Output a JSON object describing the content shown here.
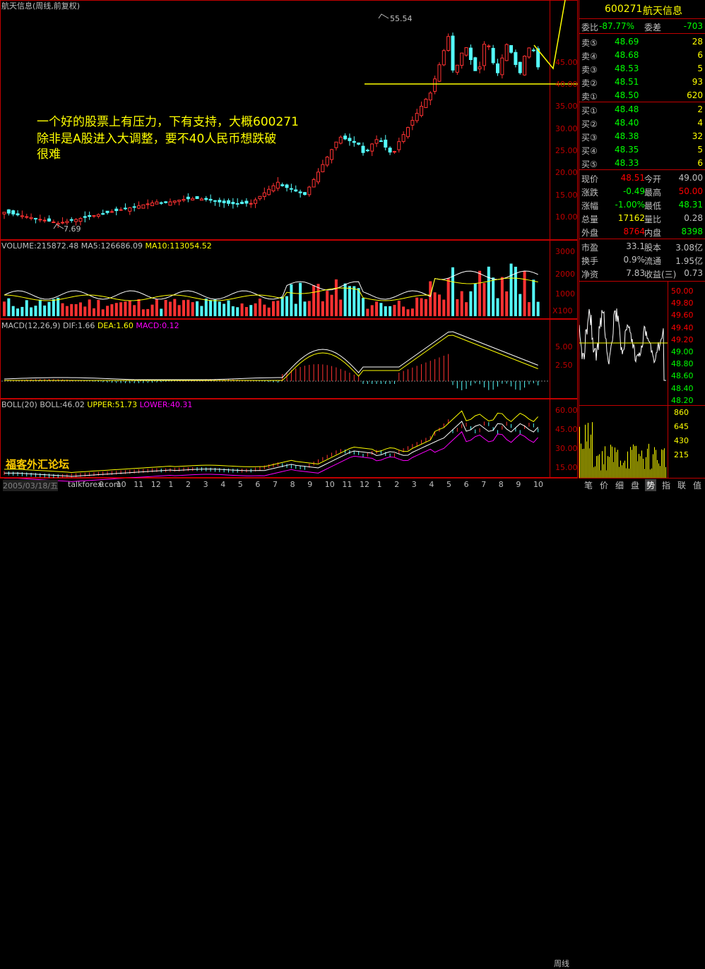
{
  "window_title": "航天信息(周线,前复权)",
  "annotation": {
    "line1": "一个好的股票上有压力，下有支持，大概600271",
    "line2": "除非是A股进入大调整，要不40人民币想跌破",
    "line3": "很难"
  },
  "price_labels": {
    "high": "55.54",
    "low": "7.69"
  },
  "price_axis": [
    "45.00",
    "40.00",
    "35.00",
    "30.00",
    "25.00",
    "20.00",
    "15.00",
    "10.00"
  ],
  "volume_panel": {
    "label": "VOLUME:215872.48",
    "ma5": "MA5:126686.09",
    "ma10": "MA10:113054.52",
    "axis": [
      "3000",
      "2000",
      "1000"
    ],
    "unit": "X100"
  },
  "macd_panel": {
    "label": "MACD(12,26,9)",
    "dif": "DIF:1.66",
    "dea": "DEA:1.60",
    "macd": "MACD:0.12",
    "axis": [
      "5.00",
      "2.50"
    ]
  },
  "boll_panel": {
    "label": "BOLL(20)",
    "boll": "BOLL:46.02",
    "upper": "UPPER:51.73",
    "lower": "LOWER:40.31",
    "axis": [
      "60.00",
      "45.00",
      "30.00",
      "15.00"
    ]
  },
  "date_label": "2005/03/18/五",
  "x_ticks": [
    "9",
    "10",
    "11",
    "12",
    "1",
    "2",
    "3",
    "4",
    "5",
    "6",
    "7",
    "8",
    "9",
    "10",
    "11",
    "12",
    "1",
    "2",
    "3",
    "4",
    "5",
    "6",
    "7",
    "8",
    "9",
    "10"
  ],
  "period": "周线",
  "watermark": "福客外汇论坛",
  "watermark2": "talkforex.com",
  "quote": {
    "code": "600271",
    "name": "航天信息",
    "weibi_label": "委比",
    "weibi_value": "-87.77%",
    "weicha_label": "委差",
    "weicha_value": "-703",
    "sells": [
      {
        "label": "卖⑤",
        "price": "48.69",
        "vol": "28"
      },
      {
        "label": "卖④",
        "price": "48.68",
        "vol": "6"
      },
      {
        "label": "卖③",
        "price": "48.53",
        "vol": "5"
      },
      {
        "label": "卖②",
        "price": "48.51",
        "vol": "93"
      },
      {
        "label": "卖①",
        "price": "48.50",
        "vol": "620"
      }
    ],
    "buys": [
      {
        "label": "买①",
        "price": "48.48",
        "vol": "2"
      },
      {
        "label": "买②",
        "price": "48.40",
        "vol": "4"
      },
      {
        "label": "买③",
        "price": "48.38",
        "vol": "32"
      },
      {
        "label": "买④",
        "price": "48.35",
        "vol": "5"
      },
      {
        "label": "买⑤",
        "price": "48.33",
        "vol": "6"
      }
    ],
    "stats": [
      {
        "l1": "现价",
        "v1": "48.51",
        "l2": "今开",
        "v2": "49.00",
        "c1": "#ff0000",
        "c2": "#c0c0c0"
      },
      {
        "l1": "涨跌",
        "v1": "-0.49",
        "l2": "最高",
        "v2": "50.00",
        "c1": "#00ff00",
        "c2": "#ff0000"
      },
      {
        "l1": "涨幅",
        "v1": "-1.00%",
        "l2": "最低",
        "v2": "48.31",
        "c1": "#00ff00",
        "c2": "#00ff00"
      },
      {
        "l1": "总量",
        "v1": "17162",
        "l2": "量比",
        "v2": "0.28",
        "c1": "#ffff00",
        "c2": "#c0c0c0"
      },
      {
        "l1": "外盘",
        "v1": "8764",
        "l2": "内盘",
        "v2": "8398",
        "c1": "#ff0000",
        "c2": "#00ff00"
      }
    ],
    "fund": [
      {
        "l1": "市盈",
        "v1": "33.1",
        "l2": "股本",
        "v2": "3.08亿"
      },
      {
        "l1": "换手",
        "v1": "0.9%",
        "l2": "流通",
        "v2": "1.95亿"
      },
      {
        "l1": "净资",
        "v1": "7.83",
        "l2": "收益(三)",
        "v2": "0.73"
      }
    ],
    "intraday_axis": [
      "50.00",
      "49.80",
      "49.60",
      "49.40",
      "49.20",
      "49.00",
      "48.80",
      "48.60",
      "48.40",
      "48.20"
    ],
    "intraday_vol_axis": [
      "860",
      "645",
      "430",
      "215"
    ]
  },
  "tabs": [
    "笔",
    "价",
    "细",
    "盘",
    "势",
    "指",
    "联",
    "值"
  ],
  "active_tab": "势"
}
